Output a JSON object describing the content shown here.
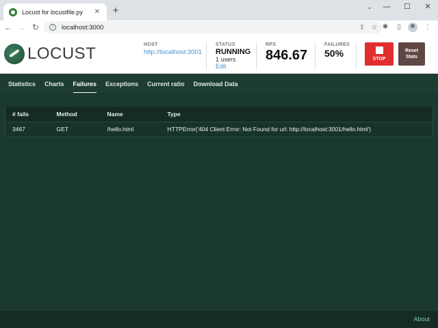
{
  "browser": {
    "tab_title": "Locust for locustfile.py",
    "tab_close": "✕",
    "new_tab": "+",
    "url": "localhost:3000",
    "window_controls": [
      "⌄",
      "—",
      "☐",
      "✕"
    ]
  },
  "header": {
    "logo_text": "LOCUST",
    "host_label": "HOST",
    "host_value": "http://localhost:3001",
    "status_label": "STATUS",
    "status_value": "RUNNING",
    "users_text": "1 users",
    "edit_label": "Edit",
    "rps_label": "RPS",
    "rps_value": "846.67",
    "failures_label": "FAILURES",
    "failures_value": "50%",
    "stop_label": "STOP",
    "reset_label_line1": "Reset",
    "reset_label_line2": "Stats"
  },
  "tabs": [
    {
      "label": "Statistics",
      "active": false
    },
    {
      "label": "Charts",
      "active": false
    },
    {
      "label": "Failures",
      "active": true
    },
    {
      "label": "Exceptions",
      "active": false
    },
    {
      "label": "Current ratio",
      "active": false
    },
    {
      "label": "Download Data",
      "active": false
    }
  ],
  "failures_table": {
    "columns": [
      "# fails",
      "Method",
      "Name",
      "Type"
    ],
    "rows": [
      [
        "3467",
        "GET",
        "/hello.html",
        "HTTPError('404 Client Error: Not Found for url: http://localhost:3001/hello.html')"
      ]
    ]
  },
  "footer": {
    "about_label": "About"
  },
  "colors": {
    "background": "#1b3a2f",
    "stop_button": "#e02d2d",
    "reset_button": "#5f4744",
    "link": "#4a8fc8"
  }
}
